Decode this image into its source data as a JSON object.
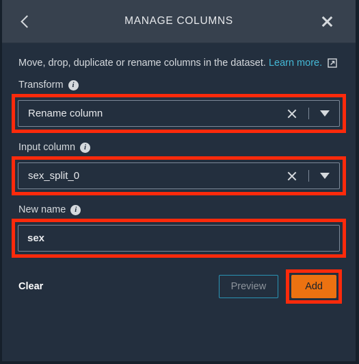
{
  "header": {
    "title": "MANAGE COLUMNS",
    "back_icon": "chevron-left-icon",
    "close_icon": "close-icon"
  },
  "description": {
    "text": "Move, drop, duplicate or rename columns in the dataset.",
    "link_text": "Learn more.",
    "external_icon": "external-link-icon"
  },
  "fields": {
    "transform": {
      "label": "Transform",
      "value": "Rename column",
      "info_icon": "info-icon",
      "clear_icon": "clear-icon",
      "caret_icon": "chevron-down-icon",
      "highlighted": true
    },
    "input_column": {
      "label": "Input column",
      "value": "sex_split_0",
      "info_icon": "info-icon",
      "clear_icon": "clear-icon",
      "caret_icon": "chevron-down-icon",
      "highlighted": true
    },
    "new_name": {
      "label": "New name",
      "value": "sex",
      "placeholder": "",
      "info_icon": "info-icon",
      "highlighted": true
    }
  },
  "actions": {
    "clear_label": "Clear",
    "preview_label": "Preview",
    "add_label": "Add"
  },
  "colors": {
    "panel_bg": "#232f3e",
    "header_bg": "#37414e",
    "accent_orange": "#ec7211",
    "link_cyan": "#44b9d6",
    "annotation_red": "#fc2a0b",
    "border_grey": "#7d8998"
  }
}
